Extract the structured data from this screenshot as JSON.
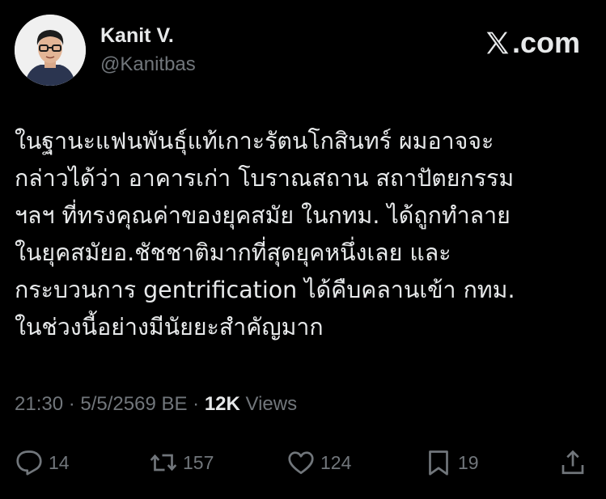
{
  "author": {
    "name": "Kanit V.",
    "handle": "@Kanitbas"
  },
  "brand": {
    "label": ".com",
    "icon": "x-logo-icon"
  },
  "tweet": {
    "lines": [
      "ในฐานะแฟนพันธุ์แท้เกาะรัตนโกสินทร์ ผมอาจจะ",
      "กล่าวได้ว่า อาคารเก่า โบราณสถาน สถาปัตยกรรม",
      "ฯลฯ ที่ทรงคุณค่าของยุคสมัย ในกทม. ได้ถูกทำลาย",
      "ในยุคสมัยอ.ชัชชาติมากที่สุดยุคหนึ่งเลย และ",
      "กระบวนการ gentrification ได้คืบคลานเข้า กทม.",
      "ในช่วงนี้อย่างมีนัยยะสำคัญมาก"
    ]
  },
  "meta": {
    "time": "21:30",
    "sep1": " · ",
    "date": "5/5/2569 BE",
    "sep2": " · ",
    "views_count": "12K",
    "views_label": " Views"
  },
  "actions": {
    "replies": "14",
    "reposts": "157",
    "likes": "124",
    "bookmarks": "19"
  }
}
